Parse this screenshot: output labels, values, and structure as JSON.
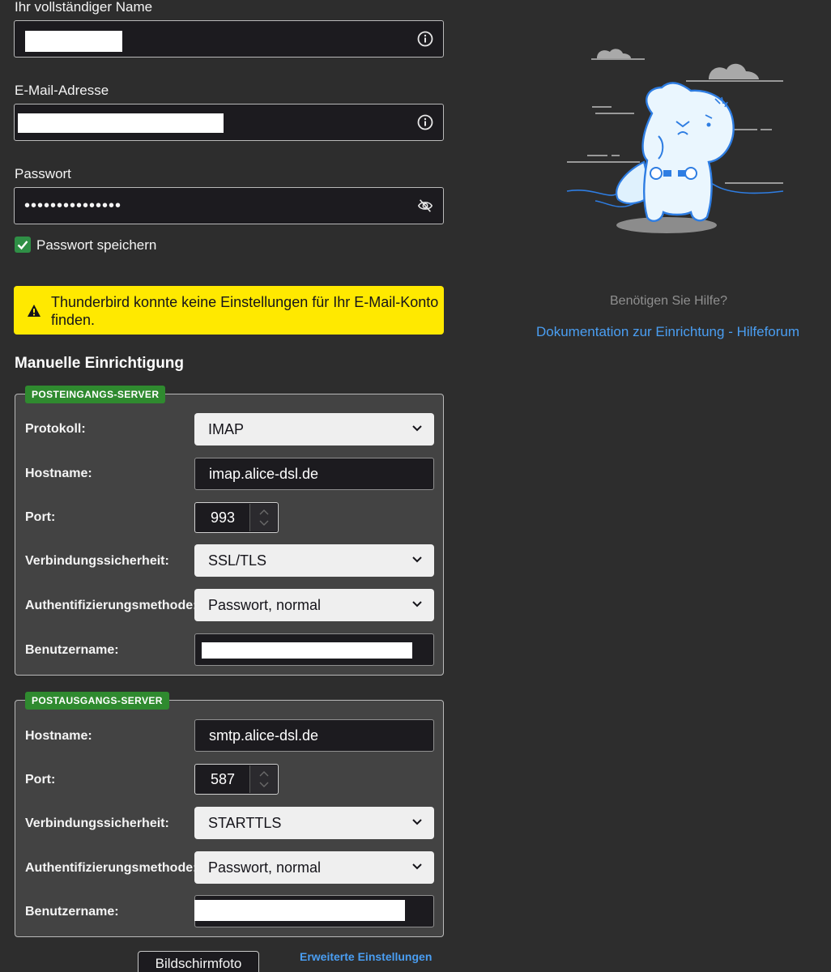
{
  "account": {
    "name_label": "Ihr vollständiger Name",
    "email_label": "E-Mail-Adresse",
    "password_label": "Passwort",
    "password_value": "•••••••••••••••",
    "remember_password_label": "Passwort speichern",
    "remember_password_checked": true
  },
  "warning": {
    "text": "Thunderbird konnte keine Einstellungen für Ihr E-Mail-Konto finden.",
    "color": "#ffe900"
  },
  "manual": {
    "title": "Manuelle Einrichtigung",
    "incoming": {
      "legend": "POSTEINGANGS-SERVER",
      "protocol_label": "Protokoll:",
      "protocol_value": "IMAP",
      "hostname_label": "Hostname:",
      "hostname_value": "imap.alice-dsl.de",
      "port_label": "Port:",
      "port_value": "993",
      "security_label": "Verbindungssicherheit:",
      "security_value": "SSL/TLS",
      "auth_label": "Authentifizierungsmethode:",
      "auth_value": "Passwort, normal",
      "username_label": "Benutzername:"
    },
    "outgoing": {
      "legend": "POSTAUSGANGS-SERVER",
      "hostname_label": "Hostname:",
      "hostname_value": "smtp.alice-dsl.de",
      "port_label": "Port:",
      "port_value": "587",
      "security_label": "Verbindungssicherheit:",
      "security_value": "STARTTLS",
      "auth_label": "Authentifizierungsmethode:",
      "auth_value": "Passwort, normal",
      "username_label": "Benutzername:"
    }
  },
  "footer": {
    "screenshot_button": "Bildschirmfoto",
    "advanced_link": "Erweiterte Einstellungen"
  },
  "help": {
    "question": "Benötigen Sie Hilfe?",
    "docs_link": "Dokumentation zur Einrichtung",
    "separator": " - ",
    "forum_link": "Hilfeforum"
  },
  "colors": {
    "background": "#2d2d2d",
    "accent_green": "#2f8a2f",
    "link_blue": "#4a9ef2"
  }
}
